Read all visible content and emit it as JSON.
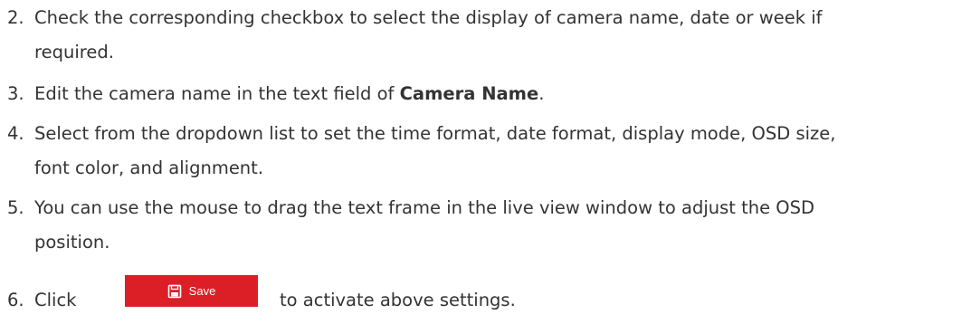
{
  "steps": [
    {
      "number": "2.",
      "lines": [
        "Check the corresponding checkbox to select the display of camera name, date or week if",
        "required."
      ]
    },
    {
      "number": "3.",
      "text_before": "Edit the camera name in the text field of ",
      "bold_text": "Camera Name",
      "text_after": "."
    },
    {
      "number": "4.",
      "lines": [
        "Select from the dropdown list to set the time format, date format, display mode, OSD size,",
        "font color, and alignment."
      ]
    },
    {
      "number": "5.",
      "lines": [
        "You can use the mouse to drag the text frame in the live view window to adjust the OSD",
        "position."
      ]
    },
    {
      "number": "6.",
      "text_before": "Click",
      "text_after": "to activate above settings."
    }
  ],
  "save_button": {
    "label": "Save",
    "icon": "floppy-disk-icon",
    "color": "#dc1f26"
  }
}
